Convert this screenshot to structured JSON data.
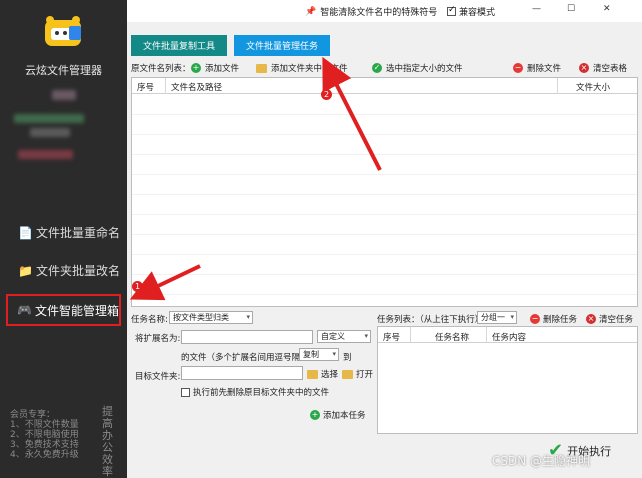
{
  "app": {
    "name": "云炫文件管理器",
    "window_title": "智能清除文件名中的特殊符号",
    "compat_mode": "兼容模式",
    "compat_checked": true
  },
  "sidebar": {
    "items": [
      {
        "label": "文件批量重命名",
        "icon": "document-icon"
      },
      {
        "label": "文件夹批量改名",
        "icon": "folder-icon"
      },
      {
        "label": "文件智能管理箱",
        "icon": "gamepad-icon",
        "active": true
      }
    ],
    "member_lines": [
      "会员专享：",
      "1、不限文件数量",
      "2、不限电脑使用",
      "3、免费技术支持",
      "4、永久免费升级"
    ],
    "vertical_text": "提高办公效率"
  },
  "tabs": [
    {
      "label": "文件批量复制工具",
      "color": "#138a87"
    },
    {
      "label": "文件批量管理任务",
      "color": "#1296e0"
    }
  ],
  "toolbar": {
    "source_list_label": "原文件名列表：",
    "add_file": "添加文件",
    "add_folder": "添加文件夹中的文件",
    "select_by_size": "选中指定大小的文件",
    "delete_file": "删除文件",
    "clear_table": "清空表格"
  },
  "main_table": {
    "columns": [
      "序号",
      "文件名及路径",
      "文件大小"
    ]
  },
  "task_form": {
    "task_name_label": "任务名称:",
    "task_name_value": "按文件类型归类",
    "ext_label": "将扩展名为:",
    "ext_mode_value": "自定义",
    "desc_text": "的文件（多个扩展名间用逗号隔开）",
    "action_value": "复制",
    "to_text": "到",
    "target_label": "目标文件夹:",
    "select_btn": "选择",
    "open_btn": "打开",
    "clear_before_label": "执行前先删除原目标文件夹中的文件",
    "add_task_btn": "添加本任务"
  },
  "task_list": {
    "label": "任务列表：（从上往下执行）",
    "group_value": "分组一",
    "delete_task": "删除任务",
    "clear_task": "清空任务",
    "columns": [
      "序号",
      "任务名称",
      "任务内容"
    ]
  },
  "start_button": "开始执行",
  "watermark": "CSDN @生隐神明",
  "annotations": [
    "1",
    "2"
  ],
  "colors": {
    "accent_red": "#e02020",
    "sidebar_bg": "#2b2b2b"
  }
}
